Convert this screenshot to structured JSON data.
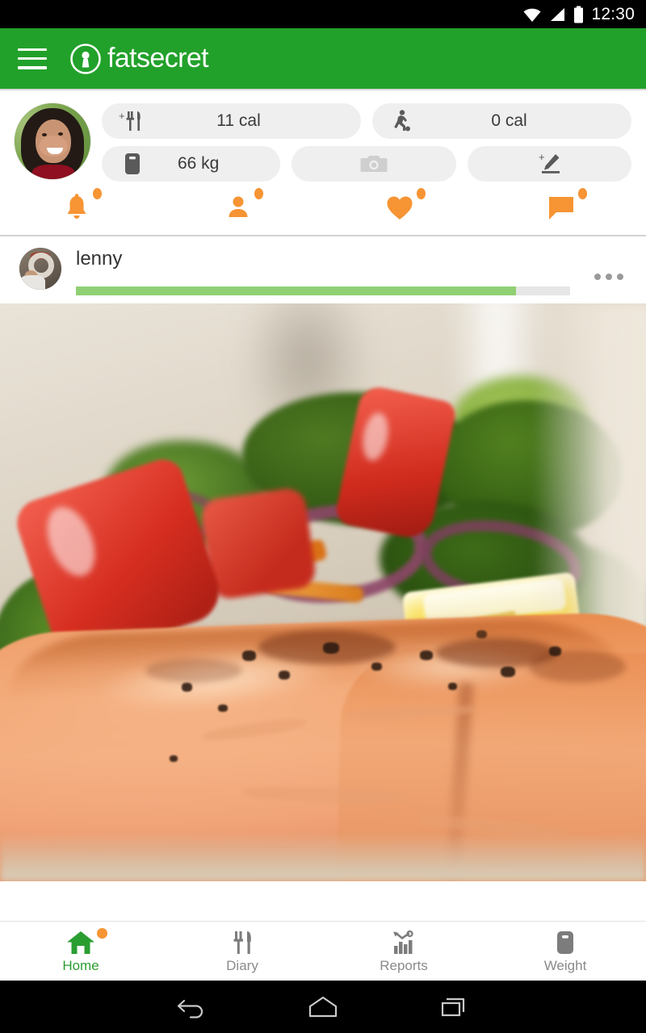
{
  "statusbar": {
    "time": "12:30",
    "icons": [
      "wifi-icon",
      "cellular-signal-icon",
      "battery-icon"
    ]
  },
  "appbar": {
    "menu_icon": "hamburger-menu-icon",
    "logo_icon": "fatsecret-keyhole-logo-icon",
    "brand": "fatsecret",
    "background_color": "#22A12A"
  },
  "stats": {
    "avatar_alt": "user-profile-photo",
    "pills": [
      {
        "id": "food-calories",
        "icon": "add-food-fork-knife-icon",
        "value": "11 cal",
        "disabled": false
      },
      {
        "id": "exercise-calories",
        "icon": "exercise-running-icon",
        "value": "0 cal",
        "disabled": false
      },
      {
        "id": "weight",
        "icon": "weight-scale-icon",
        "value": "66 kg",
        "disabled": false
      },
      {
        "id": "camera",
        "icon": "camera-icon",
        "value": "",
        "disabled": true
      },
      {
        "id": "edit-note",
        "icon": "add-edit-pencil-icon",
        "value": "",
        "disabled": false
      }
    ]
  },
  "quick_actions": [
    {
      "id": "notifications",
      "icon": "bell-icon",
      "has_badge": true
    },
    {
      "id": "buddies",
      "icon": "person-icon",
      "has_badge": true
    },
    {
      "id": "likes",
      "icon": "heart-icon",
      "has_badge": true
    },
    {
      "id": "comments",
      "icon": "speech-bubble-icon",
      "has_badge": true
    }
  ],
  "post": {
    "avatar_alt": "lenny-profile-photo",
    "username": "lenny",
    "progress_percent": 89,
    "progress_color": "#8FD072",
    "more_icon": "more-options-dots-icon",
    "image_alt": "grilled-salmon-with-salad-photo"
  },
  "bottom_nav": [
    {
      "id": "home",
      "label": "Home",
      "icon": "home-house-icon",
      "active": true,
      "has_badge": true
    },
    {
      "id": "diary",
      "label": "Diary",
      "icon": "diary-fork-knife-icon",
      "active": false,
      "has_badge": false
    },
    {
      "id": "reports",
      "label": "Reports",
      "icon": "reports-chart-icon",
      "active": false,
      "has_badge": false
    },
    {
      "id": "weight",
      "label": "Weight",
      "icon": "weight-scale-icon",
      "active": false,
      "has_badge": false
    }
  ],
  "android_nav": [
    {
      "id": "back",
      "icon": "back-arrow-icon"
    },
    {
      "id": "home",
      "icon": "home-pentagon-icon"
    },
    {
      "id": "recents",
      "icon": "recent-apps-squares-icon"
    }
  ],
  "colors": {
    "brand_green": "#22A12A",
    "accent_orange": "#F79433",
    "active_green": "#2B9E32",
    "pill_gray": "#efefef"
  }
}
